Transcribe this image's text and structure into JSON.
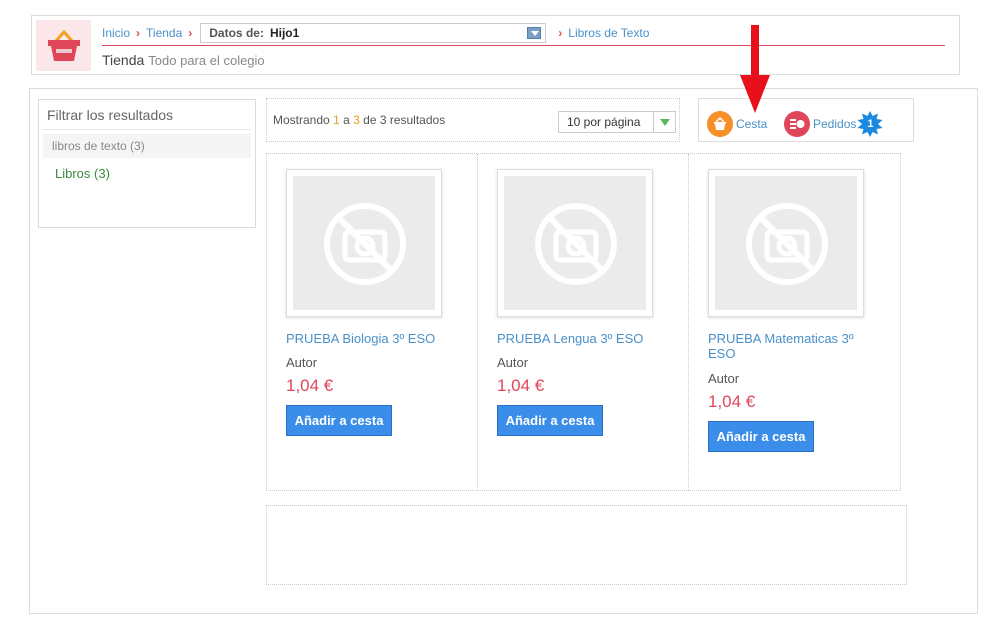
{
  "breadcrumb": {
    "inicio": "Inicio",
    "tienda": "Tienda",
    "datos_label": "Datos de:",
    "datos_value": "Hijo1",
    "libros": "Libros de Texto"
  },
  "header": {
    "title": "Tienda",
    "subtitle": "Todo para el colegio"
  },
  "filter": {
    "title": "Filtrar los resultados",
    "category": "libros de texto (3)",
    "item_label": "Libros",
    "item_count": "(3)"
  },
  "results": {
    "prefix": "Mostrando",
    "from": "1",
    "mid": "a",
    "to": "3",
    "suffix": "de 3 resultados",
    "per_page": "10 por página"
  },
  "cart": {
    "cart_label": "Cesta",
    "orders_label": "Pedidos",
    "orders_badge": "1"
  },
  "products": [
    {
      "name": "PRUEBA Biologia 3º ESO",
      "author": "Autor",
      "price": "1,04 €",
      "button": "Añadir a cesta"
    },
    {
      "name": "PRUEBA Lengua 3º ESO",
      "author": "Autor",
      "price": "1,04 €",
      "button": "Añadir a cesta"
    },
    {
      "name": "PRUEBA Matematicas 3º ESO",
      "author": "Autor",
      "price": "1,04 €",
      "button": "Añadir a cesta"
    }
  ],
  "colors": {
    "accent_red": "#e0465a",
    "link_blue": "#4a90c8",
    "button_blue": "#3a8de8",
    "cart_orange": "#f5902a",
    "badge_blue": "#1a8ae0"
  }
}
